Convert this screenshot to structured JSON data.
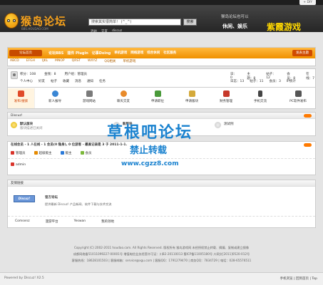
{
  "topbar": {
    "diy": "+ DIY"
  },
  "header": {
    "title": "猴岛论坛",
    "subtitle": "BBS.HOUDAO.COM",
    "search_placeholder": "搜索其实很简单！ (^_^)",
    "search_button": "搜索",
    "hot_links": [
      "浴站",
      "交友",
      "discuz"
    ],
    "promo": {
      "line1": "猴岛论坛也可以",
      "line2": "休闲、娱乐",
      "line3": "紫霞游戏"
    }
  },
  "nav": {
    "home": "论坛首页",
    "items": [
      "论坛BBS",
      "插件 Plugin",
      "记事Doing",
      "单机游戏",
      "网络游戏",
      "综合休闲",
      "社区服务"
    ],
    "right_label": "发表主题",
    "sub_items": [
      "ABCD",
      "EFGH",
      "IJKL",
      "MNOP",
      "QRST",
      "WXYZ",
      "QQ相关",
      "单机游戏"
    ]
  },
  "user": {
    "line1": [
      "积分：108",
      "金钱：8",
      "用户组：管理员"
    ],
    "line2": [
      "个人中心",
      "好友",
      "帖子",
      "收藏",
      "消息",
      "通知",
      "任务"
    ],
    "right1": [
      "日：0",
      "主题：8",
      "帖子：12",
      "会员：8",
      "在线：7"
    ],
    "right2": [
      "日志：13",
      "帖子：11",
      "会员：3",
      "IP统计"
    ]
  },
  "quick_icons": [
    "发布/搜索",
    "新人报导",
    "游戏网站",
    "聊天交友",
    "申请职位",
    "申请版块",
    "财务管理",
    "手机交流",
    "PC软件发布"
  ],
  "discuz": {
    "title": "Discuz!",
    "forums": [
      {
        "name": "默认版块",
        "desc": "版块描述已关闭"
      },
      {
        "name": "新版块",
        "desc": ""
      },
      {
        "name": "测试例",
        "desc": ""
      }
    ]
  },
  "online": {
    "title": "在线会员 - 1 人在线 - 1 会员(0 隐身), 0 位游客 - 最高记录是 3 于 2011-1-1.",
    "groups": [
      {
        "label": "管理员",
        "color": "#d9342b"
      },
      {
        "label": "超级版主",
        "color": "#e58a00"
      },
      {
        "label": "版主",
        "color": "#2b7ad9"
      },
      {
        "label": "会员",
        "color": "#7cb83a"
      }
    ],
    "users": [
      "admin"
    ]
  },
  "friends": {
    "title": "友情链接",
    "logo_text": "Discuz!",
    "name": "官方论坛",
    "desc": "提供最新 Discuz! 产品新闻、软件下载与技术交流",
    "links": [
      "Comsenz",
      "漫游平台",
      "Yeswan",
      "我的领地"
    ]
  },
  "copyright": [
    "Copyright (C) 2002-2011 houdao.com. All Rights Reserved. 版权所有 猴岛游戏网 未经授权禁止转载、摘编、复制或建立镜像",
    "成都网络备51011099227-00001号  增值电信业务经营许可证：川B2-20110013  蜀ICP备11005180号  川网文[2011]0520-012号",
    "客服热线：18628101503 | 客服邮箱：service@xgu.com | 客服QQ：1791279470 | 商务QQ：7834729 | 电话：028-65576511"
  ],
  "bottom": {
    "powered": "Powered by Discuz! X2.5",
    "links": "手机浏览 | 回到首页 | Top"
  },
  "watermark": {
    "line1": "草根吧论坛",
    "line2": "禁止转载",
    "line3": "www.cgzz8.com"
  }
}
